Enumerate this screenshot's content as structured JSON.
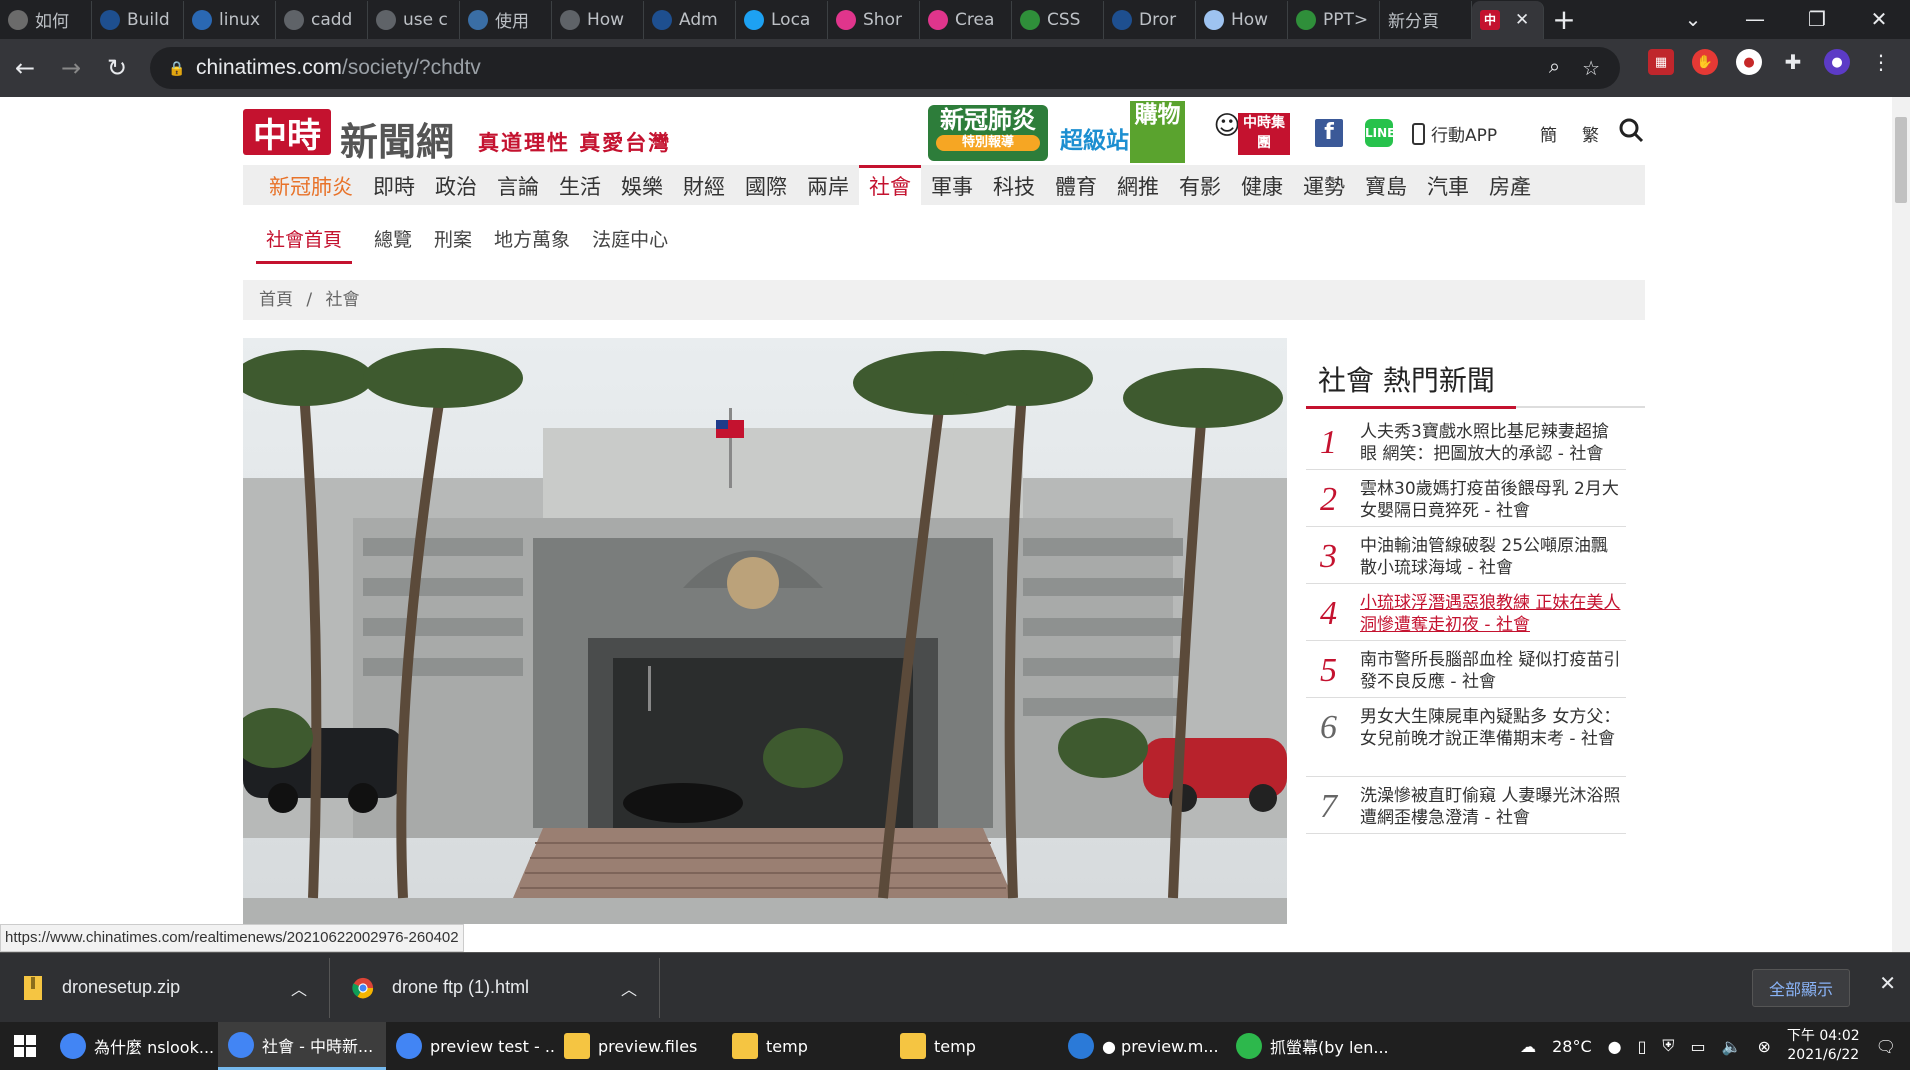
{
  "browser": {
    "tabs": [
      {
        "label": "如何",
        "favicon": "book-icon",
        "color": "#6b6b6b"
      },
      {
        "label": "Build",
        "favicon": "globe-icon",
        "color": "#1e4f8f"
      },
      {
        "label": "linux",
        "favicon": "ampersand-icon",
        "color": "#2a68b3"
      },
      {
        "label": "cadd",
        "favicon": "globe-icon",
        "color": "#5f6368"
      },
      {
        "label": "use c",
        "favicon": "globe-icon",
        "color": "#5f6368"
      },
      {
        "label": "使用",
        "favicon": "avatar-icon",
        "color": "#3a6ea5"
      },
      {
        "label": "How",
        "favicon": "globe-icon",
        "color": "#5f6368"
      },
      {
        "label": "Adm",
        "favicon": "globe-icon",
        "color": "#1e4f8f"
      },
      {
        "label": "Loca",
        "favicon": "bird-icon",
        "color": "#1da1f2"
      },
      {
        "label": "Shor",
        "favicon": "h-icon",
        "color": "#e0358c"
      },
      {
        "label": "Crea",
        "favicon": "h-icon",
        "color": "#e0358c"
      },
      {
        "label": "CSS",
        "favicon": "w-icon",
        "color": "#2f8f3a"
      },
      {
        "label": "Dror",
        "favicon": "globe-icon",
        "color": "#1e4f8f"
      },
      {
        "label": "How",
        "favicon": "page-icon",
        "color": "#9ec3f0"
      },
      {
        "label": "PPT>",
        "favicon": "chart-icon",
        "color": "#2f8f3a"
      },
      {
        "label": "新分頁",
        "favicon": "none",
        "color": "#202124"
      }
    ],
    "active_tab": {
      "label": "中",
      "close": "✕"
    },
    "new_tab": "+",
    "url_domain": "chinatimes.com",
    "url_path": "/society/?chdtv",
    "status_url": "https://www.chinatimes.com/realtimenews/20210622002976-260402"
  },
  "header": {
    "logo_mark": "中時",
    "logo_text": "新聞網",
    "slogan": "真道理性 真愛台灣",
    "promo_covid_top": "新冠肺炎",
    "promo_covid_sub": "特別報導",
    "promo_market": "超級站",
    "promo_shop": "購物",
    "promo_group": "中時集團",
    "app_label": "行動APP",
    "lang_simplified": "簡",
    "lang_traditional": "繁"
  },
  "mainnav": {
    "items": [
      "新冠肺炎",
      "即時",
      "政治",
      "言論",
      "生活",
      "娛樂",
      "財經",
      "國際",
      "兩岸",
      "社會",
      "軍事",
      "科技",
      "體育",
      "網推",
      "有影",
      "健康",
      "運勢",
      "寶島",
      "汽車",
      "房產"
    ],
    "active": "社會",
    "highlight": "新冠肺炎"
  },
  "subnav": {
    "items": [
      "社會首頁",
      "總覽",
      "刑案",
      "地方萬象",
      "法庭中心"
    ],
    "active": "社會首頁"
  },
  "breadcrumb": {
    "home": "首頁",
    "sep": "/",
    "current": "社會"
  },
  "sidebar": {
    "title": "社會 熱門新聞",
    "items": [
      {
        "num": "1",
        "text": "人夫秀3寶戲水照比基尼辣妻超搶眼 網笑：把圖放大的承認 - 社會"
      },
      {
        "num": "2",
        "text": "雲林30歲媽打疫苗後餵母乳 2月大女嬰隔日竟猝死 - 社會"
      },
      {
        "num": "3",
        "text": "中油輸油管線破裂 25公噸原油飄散小琉球海域 - 社會"
      },
      {
        "num": "4",
        "text": "小琉球浮潛遇惡狼教練 正妹在美人洞慘遭奪走初夜 - 社會"
      },
      {
        "num": "5",
        "text": "南市警所長腦部血栓 疑似打疫苗引發不良反應 - 社會"
      },
      {
        "num": "6",
        "text": "男女大生陳屍車內疑點多 女方父：女兒前晚才說正準備期末考 - 社會"
      },
      {
        "num": "7",
        "text": "洗澡慘被直盯偷窺 人妻曝光沐浴照遭網歪樓急澄清 - 社會"
      }
    ]
  },
  "downloads": {
    "items": [
      {
        "name": "dronesetup.zip"
      },
      {
        "name": "drone ftp (1).html"
      }
    ],
    "show_all": "全部顯示"
  },
  "taskbar": {
    "items": [
      {
        "label": "為什麼 nslook...",
        "color": "#4285f4"
      },
      {
        "label": "社會 - 中時新...",
        "color": "#4285f4"
      },
      {
        "label": "preview test - ...",
        "color": "#4285f4"
      },
      {
        "label": "preview.files",
        "color": "#f5c542"
      },
      {
        "label": "temp",
        "color": "#f5c542"
      },
      {
        "label": "temp",
        "color": "#f5c542"
      },
      {
        "label": "● preview.m...",
        "color": "#2b7ad8"
      },
      {
        "label": "抓螢幕(by len...",
        "color": "#2db84c"
      }
    ],
    "weather": "28°C",
    "time": "下午 04:02",
    "date": "2021/6/22"
  }
}
